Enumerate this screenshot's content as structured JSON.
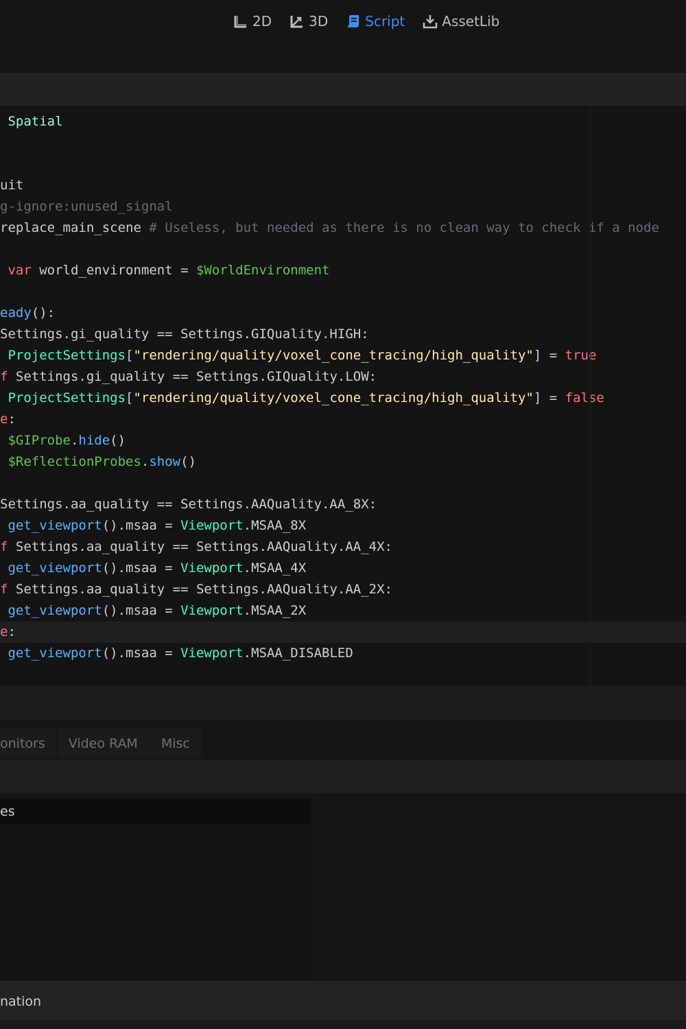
{
  "toolbar": {
    "modes": [
      {
        "label": "2D",
        "icon": "2d-viewport-icon"
      },
      {
        "label": "3D",
        "icon": "3d-viewport-icon"
      },
      {
        "label": "Script",
        "icon": "script-icon"
      },
      {
        "label": "AssetLib",
        "icon": "assetlib-download-icon"
      }
    ],
    "active_mode": "Script",
    "active_color": "#3a8ef6"
  },
  "editor": {
    "current_line_index": 24,
    "lines": [
      [
        [
          "t-cls",
          " Spatial"
        ]
      ],
      [],
      [],
      [
        [
          "pl",
          "uit"
        ]
      ],
      [
        [
          "com",
          "g-ignore:unused_signal"
        ]
      ],
      [
        [
          "pl",
          "replace_main_scene "
        ],
        [
          "com",
          "# Useless, but needed as there is no clean way to check if a node"
        ]
      ],
      [],
      [
        [
          "kw",
          " var"
        ],
        [
          "pl",
          " world_environment = "
        ],
        [
          "np",
          "$WorldEnvironment"
        ]
      ],
      [],
      [
        [
          "fn",
          "eady"
        ],
        [
          "pl",
          "():"
        ]
      ],
      [
        [
          "pl",
          "Settings.gi_quality == Settings.GIQuality.HIGH:"
        ]
      ],
      [
        [
          "ty",
          " ProjectSettings"
        ],
        [
          "pl",
          "["
        ],
        [
          "str",
          "\"rendering/quality/voxel_cone_tracing/high_quality\""
        ],
        [
          "pl",
          "] = "
        ],
        [
          "bool",
          "true"
        ]
      ],
      [
        [
          "kw",
          "f"
        ],
        [
          "pl",
          " Settings.gi_quality == Settings.GIQuality.LOW:"
        ]
      ],
      [
        [
          "ty",
          " ProjectSettings"
        ],
        [
          "pl",
          "["
        ],
        [
          "str",
          "\"rendering/quality/voxel_cone_tracing/high_quality\""
        ],
        [
          "pl",
          "] = "
        ],
        [
          "bool",
          "false"
        ]
      ],
      [
        [
          "kw",
          "e"
        ],
        [
          "pl",
          ":"
        ]
      ],
      [
        [
          "np",
          " $GIProbe"
        ],
        [
          "pl",
          "."
        ],
        [
          "fn",
          "hide"
        ],
        [
          "pl",
          "()"
        ]
      ],
      [
        [
          "np",
          " $ReflectionProbes"
        ],
        [
          "pl",
          "."
        ],
        [
          "fn",
          "show"
        ],
        [
          "pl",
          "()"
        ]
      ],
      [],
      [
        [
          "pl",
          "Settings.aa_quality == Settings.AAQuality.AA_8X:"
        ]
      ],
      [
        [
          "fn",
          " get_viewport"
        ],
        [
          "pl",
          "().msaa = "
        ],
        [
          "ty",
          "Viewport"
        ],
        [
          "pl",
          ".MSAA_8X"
        ]
      ],
      [
        [
          "kw",
          "f"
        ],
        [
          "pl",
          " Settings.aa_quality == Settings.AAQuality.AA_4X:"
        ]
      ],
      [
        [
          "fn",
          " get_viewport"
        ],
        [
          "pl",
          "().msaa = "
        ],
        [
          "ty",
          "Viewport"
        ],
        [
          "pl",
          ".MSAA_4X"
        ]
      ],
      [
        [
          "kw",
          "f"
        ],
        [
          "pl",
          " Settings.aa_quality == Settings.AAQuality.AA_2X:"
        ]
      ],
      [
        [
          "fn",
          " get_viewport"
        ],
        [
          "pl",
          "().msaa = "
        ],
        [
          "ty",
          "Viewport"
        ],
        [
          "pl",
          ".MSAA_2X"
        ]
      ],
      [
        [
          "kw",
          "e"
        ],
        [
          "pl",
          ":"
        ]
      ],
      [
        [
          "fn",
          " get_viewport"
        ],
        [
          "pl",
          "().msaa = "
        ],
        [
          "ty",
          "Viewport"
        ],
        [
          "pl",
          ".MSAA_DISABLED"
        ]
      ]
    ]
  },
  "debugger": {
    "tabs": [
      "onitors",
      "Video RAM",
      "Misc"
    ],
    "left_row": "es"
  },
  "bottom": {
    "label": "nation"
  }
}
